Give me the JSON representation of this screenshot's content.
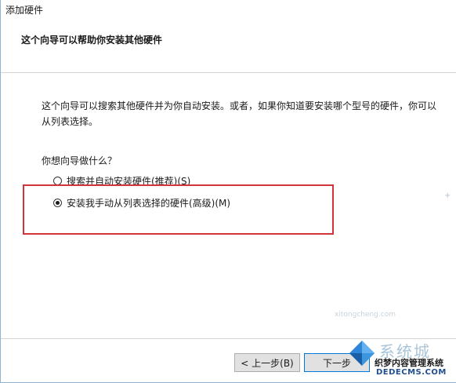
{
  "window": {
    "title": "添加硬件"
  },
  "header": {
    "title": "这个向导可以帮助你安装其他硬件"
  },
  "content": {
    "description": "这个向导可以搜索其他硬件并为你自动安装。或者，如果你知道要安装哪个型号的硬件，你可以从列表选择。",
    "question": "你想向导做什么？",
    "options": [
      {
        "label": "搜索并自动安装硬件(推荐)(S)",
        "checked": false
      },
      {
        "label": "安装我手动从列表选择的硬件(高级)(M)",
        "checked": true
      }
    ]
  },
  "footer": {
    "back_label": "< 上一步(B)",
    "next_label": "下一步"
  },
  "watermark": {
    "small_text": "xitongcheng.com",
    "big_text": "系统城",
    "cn_text": "织梦内容管理系统",
    "en_text": "DEDECMS.COM"
  },
  "colors": {
    "highlight": "#d2343e",
    "accent": "#0078d7"
  }
}
